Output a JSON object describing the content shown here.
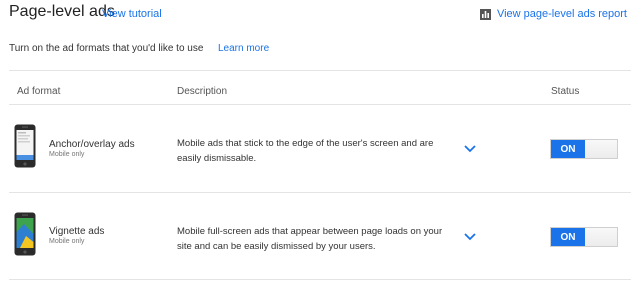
{
  "header": {
    "title": "Page-level ads",
    "view_tutorial": "View tutorial",
    "view_report": "View page-level ads report"
  },
  "intro": {
    "text": "Turn on the ad formats that you'd like to use",
    "learn_more": "Learn more"
  },
  "table": {
    "columns": [
      "Ad format",
      "Description",
      "Status"
    ],
    "rows": [
      {
        "title": "Anchor/overlay ads",
        "subtitle": "Mobile only",
        "description": "Mobile ads that stick to the edge of the user's screen and are easily dismissable.",
        "status": "ON",
        "icon": "phone-anchor-icon"
      },
      {
        "title": "Vignette ads",
        "subtitle": "Mobile only",
        "description": "Mobile full-screen ads that appear between page loads on your site and can be easily dismissed by your users.",
        "status": "ON",
        "icon": "phone-vignette-icon"
      }
    ]
  },
  "colors": {
    "accent": "#1a73e8",
    "divider": "#e4e4e4"
  }
}
